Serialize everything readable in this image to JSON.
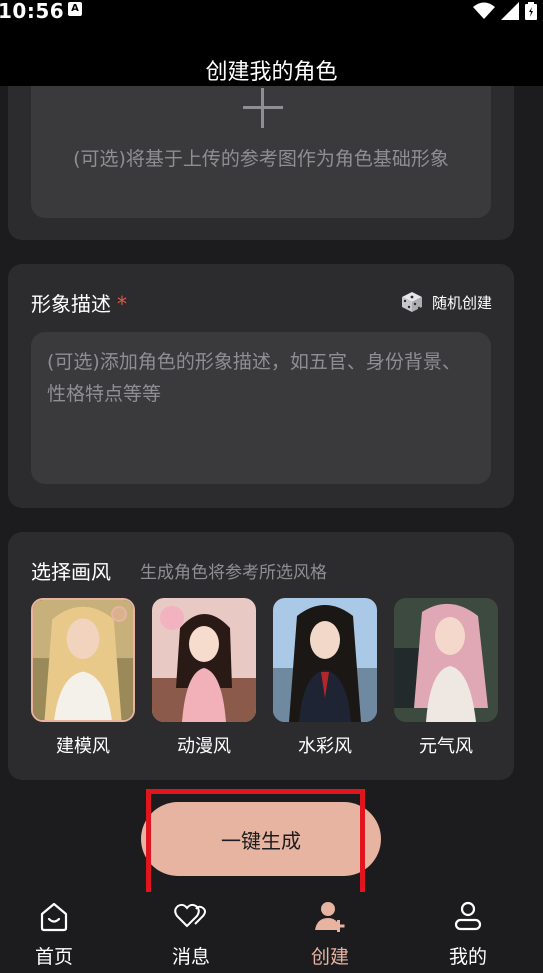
{
  "status_bar": {
    "time": "10:56",
    "notif_glyph": "A",
    "icons": [
      "wifi-icon",
      "signal-icon",
      "battery-icon"
    ]
  },
  "header": {
    "title": "创建我的角色"
  },
  "upload": {
    "hint": "(可选)将基于上传的参考图作为角色基础形象",
    "icon": "plus-icon"
  },
  "description": {
    "title": "形象描述",
    "required_mark": "*",
    "random_label": "随机创建",
    "random_icon": "dice-icon",
    "placeholder": "(可选)添加角色的形象描述，如五官、身份背景、性格特点等等"
  },
  "style": {
    "title": "选择画风",
    "subtitle": "生成角色将参考所选风格",
    "options": [
      {
        "label": "建模风",
        "selected": true
      },
      {
        "label": "动漫风",
        "selected": false
      },
      {
        "label": "水彩风",
        "selected": false
      },
      {
        "label": "元气风",
        "selected": false
      }
    ]
  },
  "generate_button": {
    "label": "一键生成"
  },
  "nav": {
    "items": [
      {
        "label": "首页",
        "icon": "home-icon",
        "active": false
      },
      {
        "label": "消息",
        "icon": "heart-message-icon",
        "active": false
      },
      {
        "label": "创建",
        "icon": "create-user-icon",
        "active": true
      },
      {
        "label": "我的",
        "icon": "profile-icon",
        "active": false
      }
    ]
  },
  "colors": {
    "accent": "#e6b4a1",
    "highlight_border": "#e0151d",
    "card": "#2c2c2e",
    "input": "#3a3a3c"
  }
}
